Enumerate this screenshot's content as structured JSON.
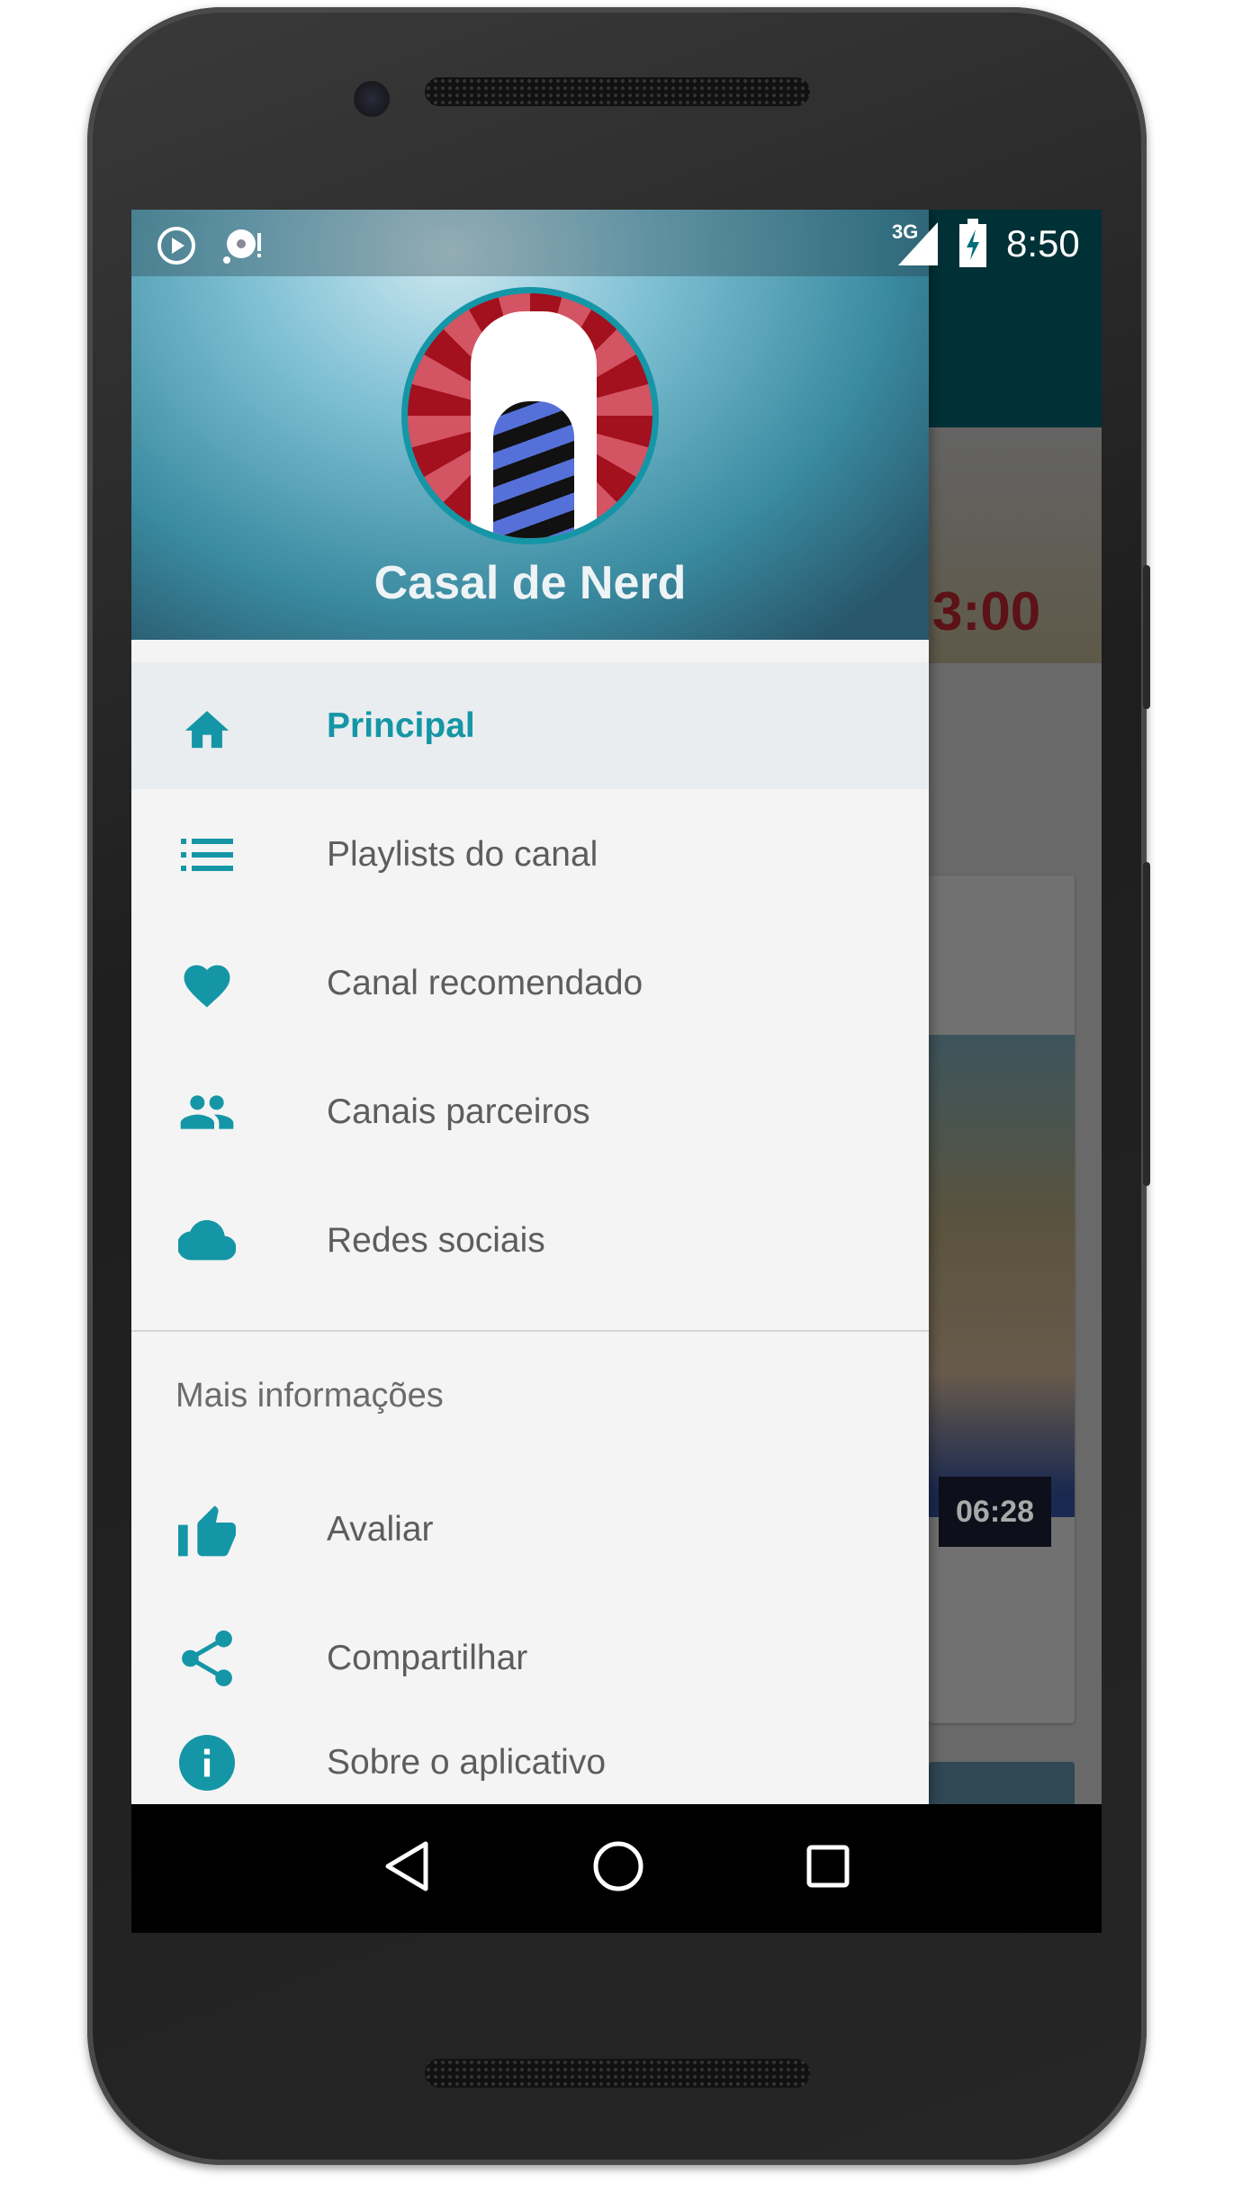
{
  "status_bar": {
    "network": "3G",
    "time": "8:50",
    "icons": [
      "play-circle-icon",
      "sync-alert-icon",
      "signal-icon",
      "battery-charging-icon"
    ]
  },
  "drawer": {
    "channel_name": "Casal de Nerd",
    "items": [
      {
        "label": "Principal",
        "icon": "home-icon",
        "active": true
      },
      {
        "label": "Playlists do canal",
        "icon": "list-icon"
      },
      {
        "label": "Canal recomendado",
        "icon": "heart-icon"
      },
      {
        "label": "Canais parceiros",
        "icon": "people-icon"
      },
      {
        "label": "Redes sociais",
        "icon": "cloud-icon"
      }
    ],
    "section_title": "Mais informações",
    "info_items": [
      {
        "label": "Avaliar",
        "icon": "thumb-up-icon"
      },
      {
        "label": "Compartilhar",
        "icon": "share-icon"
      },
      {
        "label": "Sobre o aplicativo",
        "icon": "info-icon"
      }
    ]
  },
  "background": {
    "thumb_text": "3:00",
    "video_duration": "06:28"
  },
  "colors": {
    "accent": "#1596a6",
    "toolbar": "#006d78"
  }
}
